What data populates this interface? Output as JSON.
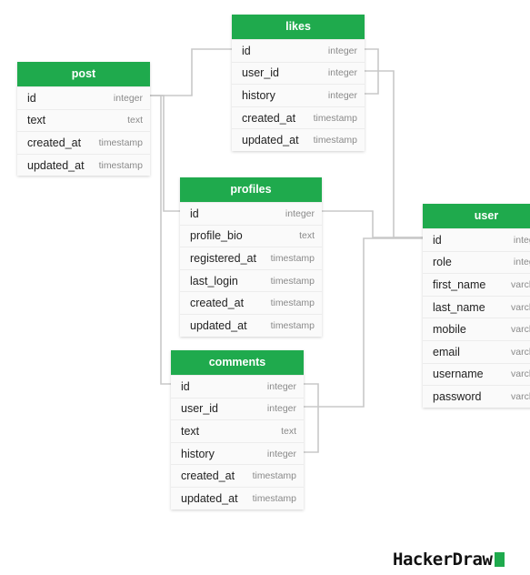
{
  "colors": {
    "header": "#1faa4d",
    "connector": "#c8c8c8",
    "logo_mark": "#1faa4d"
  },
  "brand": {
    "text": "HackerDraw"
  },
  "tables": [
    {
      "key": "post",
      "name": "post",
      "fields": [
        {
          "name": "id",
          "type": "integer"
        },
        {
          "name": "text",
          "type": "text"
        },
        {
          "name": "created_at",
          "type": "timestamp"
        },
        {
          "name": "updated_at",
          "type": "timestamp"
        }
      ]
    },
    {
      "key": "likes",
      "name": "likes",
      "fields": [
        {
          "name": "id",
          "type": "integer"
        },
        {
          "name": "user_id",
          "type": "integer"
        },
        {
          "name": "history",
          "type": "integer"
        },
        {
          "name": "created_at",
          "type": "timestamp"
        },
        {
          "name": "updated_at",
          "type": "timestamp"
        }
      ]
    },
    {
      "key": "profiles",
      "name": "profiles",
      "fields": [
        {
          "name": "id",
          "type": "integer"
        },
        {
          "name": "profile_bio",
          "type": "text"
        },
        {
          "name": "registered_at",
          "type": "timestamp"
        },
        {
          "name": "last_login",
          "type": "timestamp"
        },
        {
          "name": "created_at",
          "type": "timestamp"
        },
        {
          "name": "updated_at",
          "type": "timestamp"
        }
      ]
    },
    {
      "key": "user",
      "name": "user",
      "fields": [
        {
          "name": "id",
          "type": "integer"
        },
        {
          "name": "role",
          "type": "integer"
        },
        {
          "name": "first_name",
          "type": "varchar"
        },
        {
          "name": "last_name",
          "type": "varchar"
        },
        {
          "name": "mobile",
          "type": "varchar"
        },
        {
          "name": "email",
          "type": "varchar"
        },
        {
          "name": "username",
          "type": "varchar"
        },
        {
          "name": "password",
          "type": "varchar"
        }
      ]
    },
    {
      "key": "comments",
      "name": "comments",
      "fields": [
        {
          "name": "id",
          "type": "integer"
        },
        {
          "name": "user_id",
          "type": "integer"
        },
        {
          "name": "text",
          "type": "text"
        },
        {
          "name": "history",
          "type": "integer"
        },
        {
          "name": "created_at",
          "type": "timestamp"
        },
        {
          "name": "updated_at",
          "type": "timestamp"
        }
      ]
    }
  ]
}
